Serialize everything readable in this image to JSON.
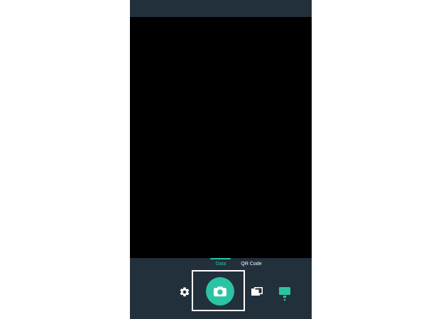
{
  "modes": {
    "data_label": "Data",
    "qr_label": "QR Code"
  },
  "icons": {
    "settings": "gear-icon",
    "shutter": "camera-icon",
    "gallery": "gallery-icon",
    "screen": "screen-icon"
  },
  "colors": {
    "accent": "#2cc3a4",
    "panel": "#22303c",
    "viewfinder": "#000000"
  }
}
